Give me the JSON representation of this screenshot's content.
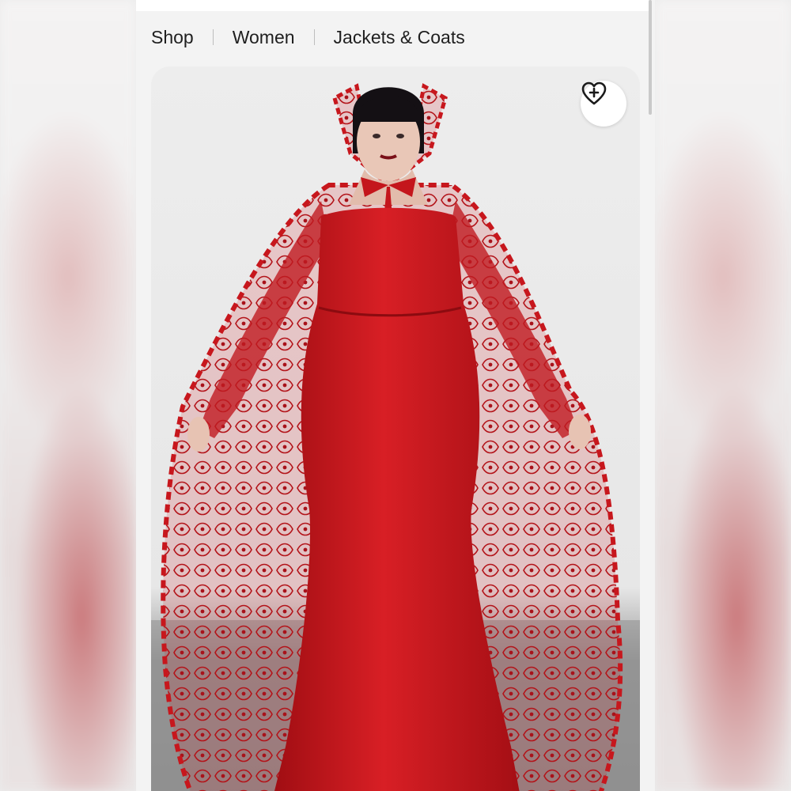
{
  "breadcrumb": {
    "items": [
      "Shop",
      "Women",
      "Jackets & Coats"
    ]
  },
  "product": {
    "image_description_icon": "product-photo",
    "wishlist_icon": "heart-plus-icon"
  },
  "colors": {
    "accent_red": "#c4161c",
    "background": "#f3f3f3"
  }
}
